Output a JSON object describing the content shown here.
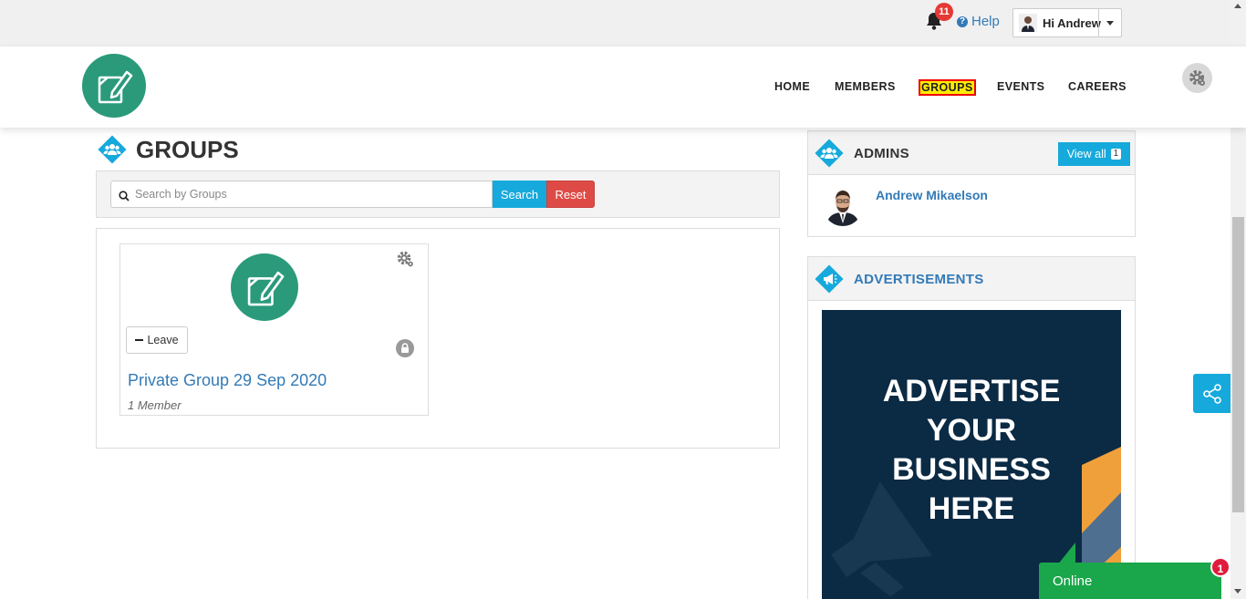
{
  "topbar": {
    "notifications_count": "11",
    "help_label": "Help",
    "user_greeting": "Hi Andrew"
  },
  "nav": {
    "items": [
      "HOME",
      "MEMBERS",
      "GROUPS",
      "EVENTS",
      "CAREERS"
    ],
    "active": "GROUPS"
  },
  "page": {
    "title": "GROUPS"
  },
  "search": {
    "placeholder": "Search by Groups",
    "value": "",
    "search_label": "Search",
    "reset_label": "Reset"
  },
  "groups": [
    {
      "leave_label": "Leave",
      "title": "Private Group 29 Sep 2020",
      "members": "1 Member",
      "privacy": "lock-icon"
    }
  ],
  "admins": {
    "title": "ADMINS",
    "view_all_label": "View all",
    "view_all_count": "1",
    "items": [
      {
        "name": "Andrew Mikaelson"
      }
    ]
  },
  "ads": {
    "title": "ADVERTISEMENTS",
    "banner_lines": [
      "ADVERTISE",
      "YOUR",
      "BUSINESS",
      "HERE"
    ]
  },
  "chat": {
    "status_label": "Online",
    "unread_count": "1"
  },
  "colors": {
    "brand_green": "#2a9a7b",
    "accent_blue": "#16a9dc",
    "reset_red": "#de4b46",
    "online_green": "#1aa64a",
    "ad_navy": "#0b2a44"
  }
}
